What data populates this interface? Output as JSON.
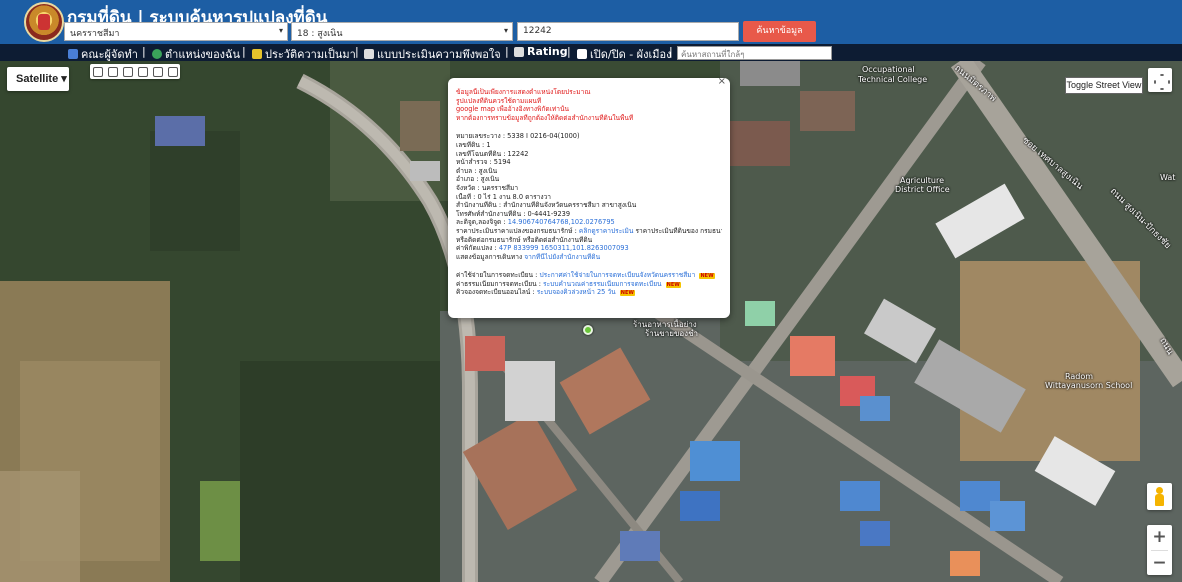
{
  "header": {
    "title": "กรมที่ดิน | ระบบค้นหารูปแปลงที่ดิน",
    "province_select": "นครราชสีมา",
    "district_select": "18 : สูงเนิน",
    "parcel_input": "12242",
    "search_button": "ค้นหาข้อมูล"
  },
  "menu": {
    "items": [
      {
        "label": "คณะผู้จัดทำ",
        "icon": "people-icon",
        "color": "#4a7fd6"
      },
      {
        "label": "ตำแหน่งของฉัน",
        "icon": "globe-icon",
        "color": "#3aa35a"
      },
      {
        "label": "ประวัติความเป็นมา",
        "icon": "history-icon",
        "color": "#e5c32b"
      },
      {
        "label": "แบบประเมินความพึงพอใจ",
        "icon": "form-icon",
        "color": "#ddd"
      },
      {
        "label": "Rating",
        "icon": "rating-icon",
        "color": "#ddd"
      },
      {
        "label": "เปิด/ปิด - ผังเมือง",
        "icon": "toggle-icon",
        "color": "#fff"
      }
    ],
    "search_placeholder": "ค้นหาสถานที่ใกล้ๆ"
  },
  "map": {
    "type_button": "Satellite",
    "street_view_button": "Toggle Street View",
    "zoom_in": "+",
    "zoom_out": "−",
    "labels": {
      "school_top": "Occupational",
      "school_top_sub": "Technical College",
      "agri": "Agriculture",
      "agri_sub": "District Office",
      "radom": "Radom",
      "radom_sub": "Wittayanusorn School",
      "wat": "Wat",
      "road_1": "ถนนมิตรภาพ",
      "road_2": "ซอย เทศบาลสูงเนิน",
      "road_3": "ถนน สูงเนิน-ปักธงชัย",
      "road_4": "ถนน",
      "place_near": "ร้านอาหารเนื้อย่าง",
      "place_near_2": "ร้านขายของชำ"
    }
  },
  "infowindow": {
    "warning_lines": [
      "ข้อมูลนี้เป็นเพียงการแสดงตำแหน่งโดยประมาณ",
      "รูปแปลงที่ดินควรใช้ตามแผนที่",
      "google map เพื่ออ้างอิงทางพิกัดเท่านั้น",
      "หากต้องการทราบข้อมูลที่ถูกต้องให้ติดต่อสำนักงานที่ดินในพื้นที่"
    ],
    "fields": [
      "หมายเลขระวาง : 5338 I 0216-04(1000)",
      "เลขที่ดิน : 1",
      "เลขที่โฉนดที่ดิน : 12242",
      "หน้าสำรวจ : 5194",
      "ตำบล : สูงเนิน",
      "อำเภอ : สูงเนิน",
      "จังหวัด : นครราชสีมา",
      "เนื้อที่ : 0 ไร่ 1 งาน 8.0 ตารางวา",
      "สำนักงานที่ดิน : สำนักงานที่ดินจังหวัดนครราชสีมา สาขาสูงเนิน",
      "โทรศัพท์สำนักงานที่ดิน : 0-4441-9239"
    ],
    "latlng_label": "ละติจูด,ลองจิจูด :",
    "latlng_value": "14.906740764768,102.0276795",
    "price_label": "ราคาประเมินราคาแปลงของกรมธนารักษ์ :",
    "price_link": "คลิกดูราคาประเมิน",
    "price_suffix": "ราคาประเมินที่ดินของ กรมธนารักษ์",
    "price_note": "หรือติดต่อกรมธนารักษ์ หรือติดต่อสำนักงานที่ดิน",
    "utm_label": "ค่าพิกัดแปลง :",
    "utm_value": "47P 833999 1650311,101.8263007093",
    "complain_label": "แสดงข้อมูลการเดินทาง",
    "complain_link": "จากที่นี่ไปยังสำนักงานที่ดิน",
    "bottom": [
      {
        "label": "ค่าใช้จ่ายในการจดทะเบียน :",
        "link": "ประกาศค่าใช้จ่ายในการจดทะเบียนจังหวัดนครราชสีมา"
      },
      {
        "label": "ค่าธรรมเนียมการจดทะเบียน :",
        "link": "ระบบคำนวณค่าธรรมเนียมการจดทะเบียน"
      },
      {
        "label": "คิวจองจดทะเบียนออนไลน์ :",
        "link": "ระบบจองคิวล่วงหน้า 25 วัน"
      }
    ],
    "new_badge": "NEW",
    "close": "×"
  },
  "colors": {
    "header_bg": "#1d5ea4",
    "menubar_bg": "#0d1c33",
    "search_button_bg": "#e8594a",
    "warning_text": "#e01919",
    "link_text": "#2a6fd8",
    "marker": "#6ac53a"
  }
}
